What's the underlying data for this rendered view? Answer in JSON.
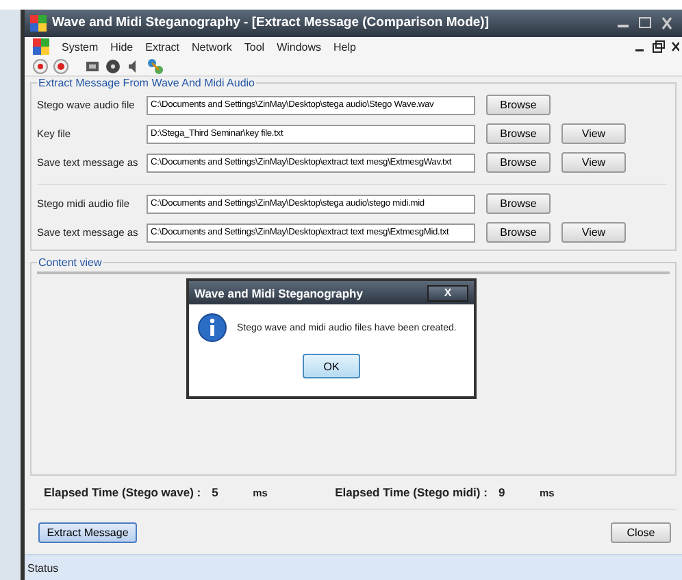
{
  "window": {
    "title": "Wave and Midi Steganography - [Extract Message (Comparison Mode)]"
  },
  "menu": [
    "System",
    "Hide",
    "Extract",
    "Network",
    "Tool",
    "Windows",
    "Help"
  ],
  "extract_group": {
    "title": "Extract Message From Wave And Midi Audio",
    "wave_rows": [
      {
        "label": "Stego wave audio file",
        "value": "C:\\Documents and Settings\\ZinMay\\Desktop\\stega audio\\Stego Wave.wav",
        "buttons": [
          "Browse"
        ]
      },
      {
        "label": "Key file",
        "value": "D:\\Stega_Third Seminar\\key file.txt",
        "buttons": [
          "Browse",
          "View"
        ]
      },
      {
        "label": "Save text message as",
        "value": "C:\\Documents and Settings\\ZinMay\\Desktop\\extract text mesg\\ExtmesgWav.txt",
        "buttons": [
          "Browse",
          "View"
        ]
      }
    ],
    "midi_rows": [
      {
        "label": "Stego midi audio file",
        "value": "C:\\Documents and Settings\\ZinMay\\Desktop\\stega audio\\stego midi.mid",
        "buttons": [
          "Browse"
        ]
      },
      {
        "label": "Save text message as",
        "value": "C:\\Documents and Settings\\ZinMay\\Desktop\\extract text mesg\\ExtmesgMid.txt",
        "buttons": [
          "Browse",
          "View"
        ]
      }
    ]
  },
  "content_view": {
    "title": "Content view"
  },
  "elapsed": [
    {
      "label": "Elapsed Time (Stego wave) :",
      "value": "5",
      "unit": "ms"
    },
    {
      "label": "Elapsed Time (Stego midi) :",
      "value": "9",
      "unit": "ms"
    }
  ],
  "buttons": {
    "extract": "Extract Message",
    "close": "Close"
  },
  "status_bar": {
    "text": "Status"
  },
  "dialog": {
    "title": "Wave and Midi Steganography",
    "message": "Stego wave and midi audio files have been created.",
    "button": "OK",
    "close": "X"
  }
}
